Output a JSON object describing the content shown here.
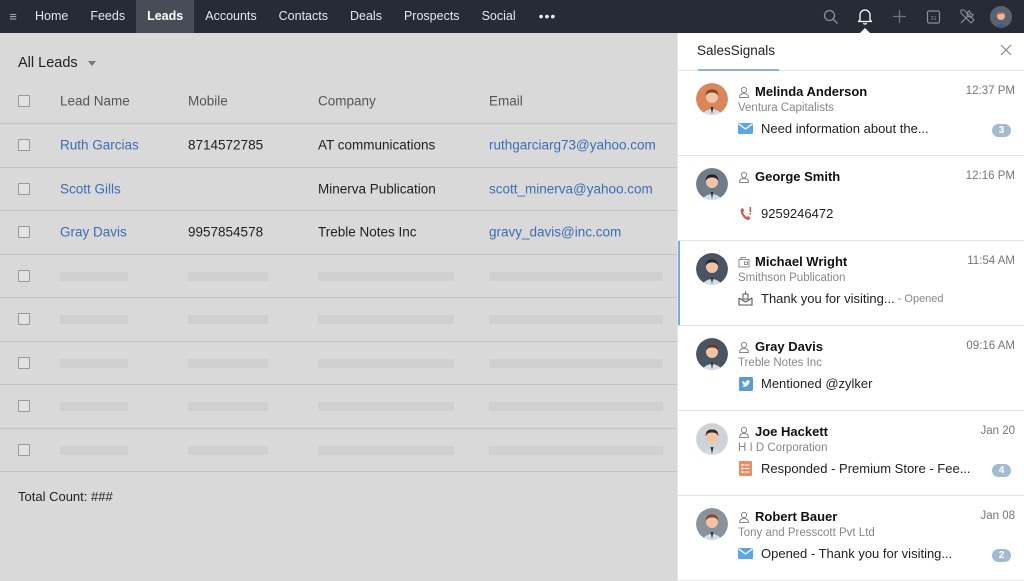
{
  "topbar": {
    "nav": [
      {
        "label": "Home"
      },
      {
        "label": "Feeds"
      },
      {
        "label": "Leads",
        "active": true
      },
      {
        "label": "Accounts"
      },
      {
        "label": "Contacts"
      },
      {
        "label": "Deals"
      },
      {
        "label": "Prospects"
      },
      {
        "label": "Social"
      }
    ],
    "more_label": "•••",
    "icons": [
      "search-icon",
      "bell-icon",
      "plus-icon",
      "calendar-icon",
      "tools-icon",
      "user-avatar"
    ],
    "calendar_day": "31"
  },
  "main": {
    "view_label": "All Leads",
    "columns": {
      "name": "Lead Name",
      "mobile": "Mobile",
      "company": "Company",
      "email": "Email"
    },
    "rows": [
      {
        "name": "Ruth Garcias",
        "mobile": "8714572785",
        "company": "AT communications",
        "email": "ruthgarciarg73@yahoo.com"
      },
      {
        "name": "Scott Gills",
        "mobile": "",
        "company": "Minerva Publication",
        "email": "scott_minerva@yahoo.com"
      },
      {
        "name": "Gray Davis",
        "mobile": "9957854578",
        "company": "Treble Notes Inc",
        "email": "gravy_davis@inc.com"
      }
    ],
    "placeholder_rows": 5,
    "total_label": "Total Count: ###"
  },
  "panel": {
    "title": "SalesSignals",
    "signals": [
      {
        "name": "Melinda Anderson",
        "time": "12:37 PM",
        "company": "Ventura Capitalists",
        "message": "Need information about the...",
        "sub": "",
        "badge": "3",
        "type_icon": "person-icon",
        "msg_icon": "email-icon",
        "avatar_bg": "#d9875a",
        "hair": "#7a4a2b",
        "selected": false
      },
      {
        "name": "George Smith",
        "time": "12:16 PM",
        "company": "",
        "message": "9259246472",
        "sub": "",
        "badge": "",
        "type_icon": "person-icon",
        "msg_icon": "missed-call-icon",
        "avatar_bg": "#6f7d8a",
        "hair": "#222222",
        "selected": false
      },
      {
        "name": "Michael Wright",
        "time": "11:54 AM",
        "company": "Smithson Publication",
        "message": "Thank you for visiting...",
        "sub": "- Opened",
        "badge": "",
        "type_icon": "account-icon",
        "msg_icon": "campaign-icon",
        "avatar_bg": "#4b5562",
        "hair": "#2b2b2b",
        "selected": true
      },
      {
        "name": "Gray Davis",
        "time": "09:16 AM",
        "company": "Treble Notes Inc",
        "message": "Mentioned @zylker",
        "sub": "",
        "badge": "",
        "type_icon": "person-icon",
        "msg_icon": "twitter-icon",
        "avatar_bg": "#4b5562",
        "hair": "#6b3a1e",
        "selected": false
      },
      {
        "name": "Joe Hackett",
        "time": "Jan 20",
        "company": "H I D Corporation",
        "message": "Responded - Premium Store - Fee...",
        "sub": "",
        "badge": "4",
        "type_icon": "person-icon",
        "msg_icon": "survey-icon",
        "avatar_bg": "#cfd3d8",
        "hair": "#3a2a20",
        "selected": false
      },
      {
        "name": "Robert Bauer",
        "time": "Jan 08",
        "company": "Tony and Presscott Pvt Ltd",
        "message": "Opened - Thank you for visiting...",
        "sub": "",
        "badge": "2",
        "type_icon": "person-icon",
        "msg_icon": "email-icon",
        "avatar_bg": "#8a929c",
        "hair": "#8a4a2a",
        "selected": false
      }
    ]
  },
  "colors": {
    "topbar_bg": "#262b36",
    "link": "#3d6db5",
    "badge": "#a4b9d2",
    "selected_accent": "#7ea5e8",
    "email_icon": "#5aa7e8",
    "missed_call": "#e0524a",
    "twitter": "#5b9bd5",
    "survey": "#ef8b60"
  }
}
